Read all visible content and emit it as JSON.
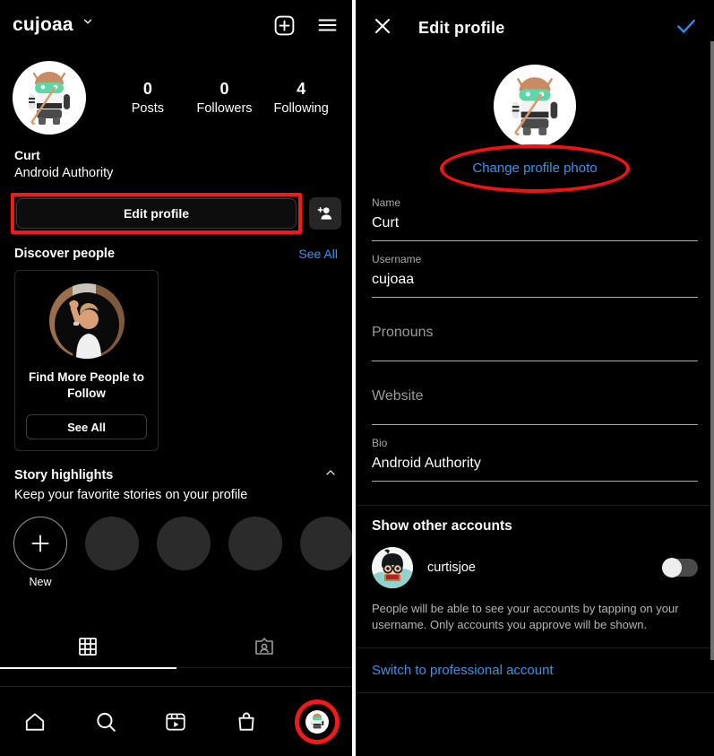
{
  "profile": {
    "username": "cujoaa",
    "chevron_icon": "chevron-down-icon",
    "header_icons": [
      "plus-square-icon",
      "hamburger-menu-icon"
    ],
    "avatar_icon": "android-mascot-avatar",
    "stats": [
      {
        "value": "0",
        "label": "Posts"
      },
      {
        "value": "0",
        "label": "Followers"
      },
      {
        "value": "4",
        "label": "Following"
      }
    ],
    "display_name": "Curt",
    "bio": "Android Authority",
    "edit_profile_label": "Edit profile",
    "add_user_icon": "add-person-icon",
    "highlight_color": "#f11a1a",
    "discover": {
      "title": "Discover people",
      "see_all": "See All",
      "card": {
        "avatar_icon": "waving-person-photo",
        "text": "Find More People to Follow",
        "button": "See All"
      }
    },
    "story_highlights": {
      "title": "Story highlights",
      "subtitle": "Keep your favorite stories on your profile",
      "collapse_icon": "chevron-up-icon",
      "new_label": "New",
      "new_icon": "plus-icon",
      "placeholder_count": 4
    },
    "tabs": [
      {
        "icon": "grid-icon",
        "active": true
      },
      {
        "icon": "tagged-person-icon",
        "active": false
      }
    ],
    "bottom_nav": [
      {
        "icon": "home-icon"
      },
      {
        "icon": "search-icon"
      },
      {
        "icon": "reels-icon"
      },
      {
        "icon": "shop-bag-icon"
      },
      {
        "icon": "profile-avatar-icon",
        "highlighted": true
      }
    ]
  },
  "edit_profile": {
    "close_icon": "close-x-icon",
    "title": "Edit profile",
    "confirm_icon": "check-icon",
    "confirm_color": "#2f8fe0",
    "avatar_icon": "android-mascot-avatar",
    "change_photo_label": "Change profile photo",
    "change_photo_color": "#3f91e8",
    "highlight_color": "#ee1414",
    "fields": [
      {
        "label": "Name",
        "value": "Curt",
        "placeholder": ""
      },
      {
        "label": "Username",
        "value": "cujoaa",
        "placeholder": ""
      },
      {
        "label": "",
        "value": "",
        "placeholder": "Pronouns"
      },
      {
        "label": "",
        "value": "",
        "placeholder": "Website"
      },
      {
        "label": "Bio",
        "value": "Android Authority",
        "placeholder": ""
      }
    ],
    "show_other_accounts": {
      "title": "Show other accounts",
      "account": {
        "avatar_icon": "cartoon-person-avatar",
        "name": "curtisjoe",
        "toggle_on": false
      },
      "description": "People will be able to see your accounts by tapping on your username. Only accounts you approve will be shown."
    },
    "professional_link": "Switch to professional account"
  }
}
